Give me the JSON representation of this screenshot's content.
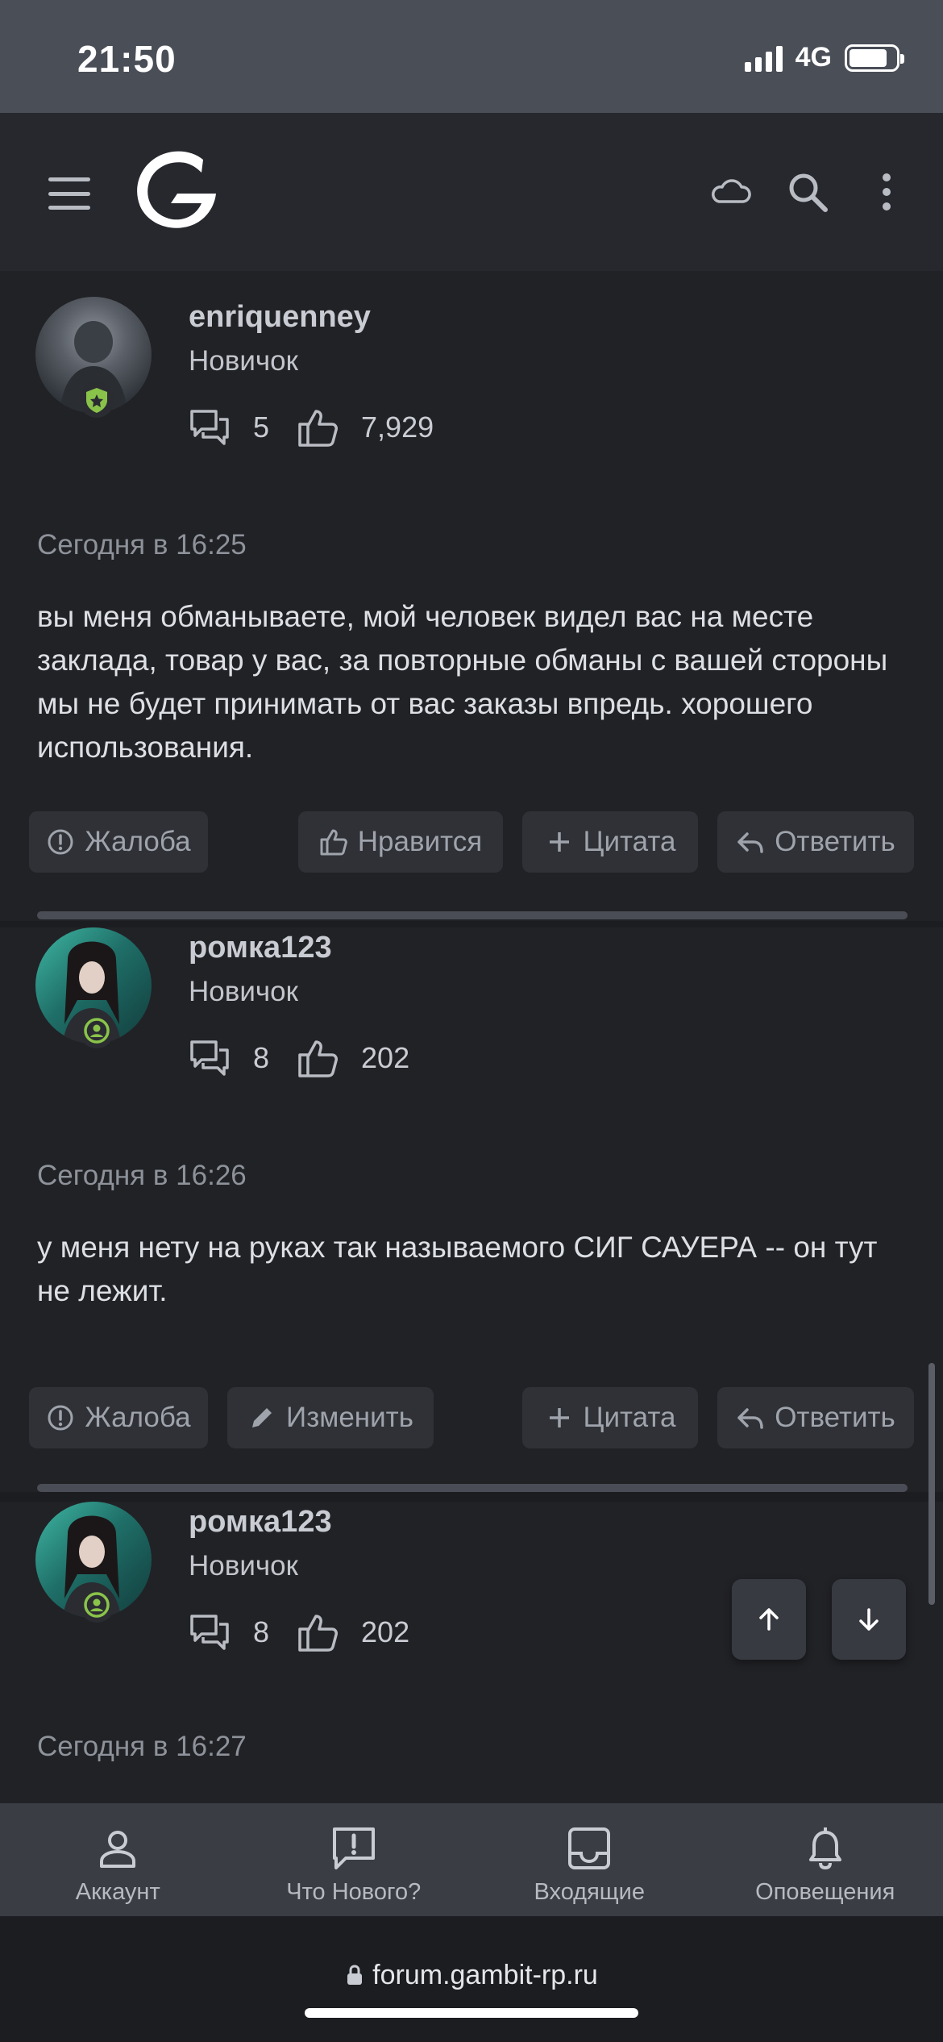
{
  "status": {
    "time": "21:50",
    "network": "4G"
  },
  "colors": {
    "accent_green": "#8ac34a",
    "background": "#1c1d21",
    "card": "#212226",
    "header": "#26282e"
  },
  "header": {
    "icons": [
      "menu-icon",
      "gambit-logo",
      "cloud-icon",
      "search-icon",
      "more-icon"
    ]
  },
  "posts": [
    {
      "username": "enriquenney",
      "user_title": "Новичок",
      "messages_count": "5",
      "reactions_count": "7,929",
      "timestamp": "Сегодня в 16:25",
      "message": "вы меня обманываете, мой человек видел вас на месте заклада, товар у вас, за повторные обманы с вашей стороны мы не будет принимать от вас заказы впредь. хорошего использования.",
      "actions": [
        "Жалоба",
        "Нравится",
        "Цитата",
        "Ответить"
      ]
    },
    {
      "username": "ромка123",
      "user_title": "Новичок",
      "messages_count": "8",
      "reactions_count": "202",
      "timestamp": "Сегодня в 16:26",
      "message": "у меня нету на руках так называемого СИГ САУЕРА -- он тут не лежит.",
      "actions": [
        "Жалоба",
        "Изменить",
        "Цитата",
        "Ответить"
      ]
    },
    {
      "username": "ромка123",
      "user_title": "Новичок",
      "messages_count": "8",
      "reactions_count": "202",
      "timestamp": "Сегодня в 16:27"
    }
  ],
  "bottom_nav": [
    {
      "label": "Аккаунт",
      "icon": "account-icon"
    },
    {
      "label": "Что Нового?",
      "icon": "whats-new-icon"
    },
    {
      "label": "Входящие",
      "icon": "inbox-icon"
    },
    {
      "label": "Оповещения",
      "icon": "bell-icon"
    }
  ],
  "url": "forum.gambit-rp.ru"
}
